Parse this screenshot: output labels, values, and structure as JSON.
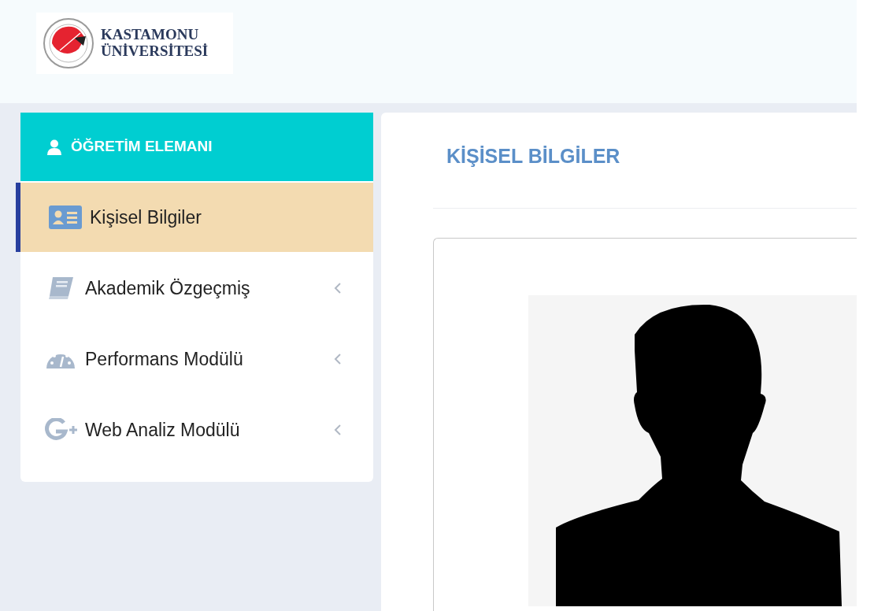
{
  "header": {
    "logo": {
      "line1": "KASTAMONU",
      "line2": "ÜNİVERSİTESİ"
    }
  },
  "sidebar": {
    "title": "ÖĞRETİM ELEMANI",
    "items": [
      {
        "label": "Kişisel Bilgiler",
        "kind": "id-card",
        "selected": true,
        "expandable": false
      },
      {
        "label": "Akademik Özgeçmiş",
        "kind": "book",
        "selected": false,
        "expandable": true
      },
      {
        "label": "Performans Modülü",
        "kind": "gauge",
        "selected": false,
        "expandable": true
      },
      {
        "label": "Web Analiz Modülü",
        "kind": "gplus",
        "selected": false,
        "expandable": true
      }
    ]
  },
  "main": {
    "title": "KİŞİSEL BİLGİLER"
  }
}
